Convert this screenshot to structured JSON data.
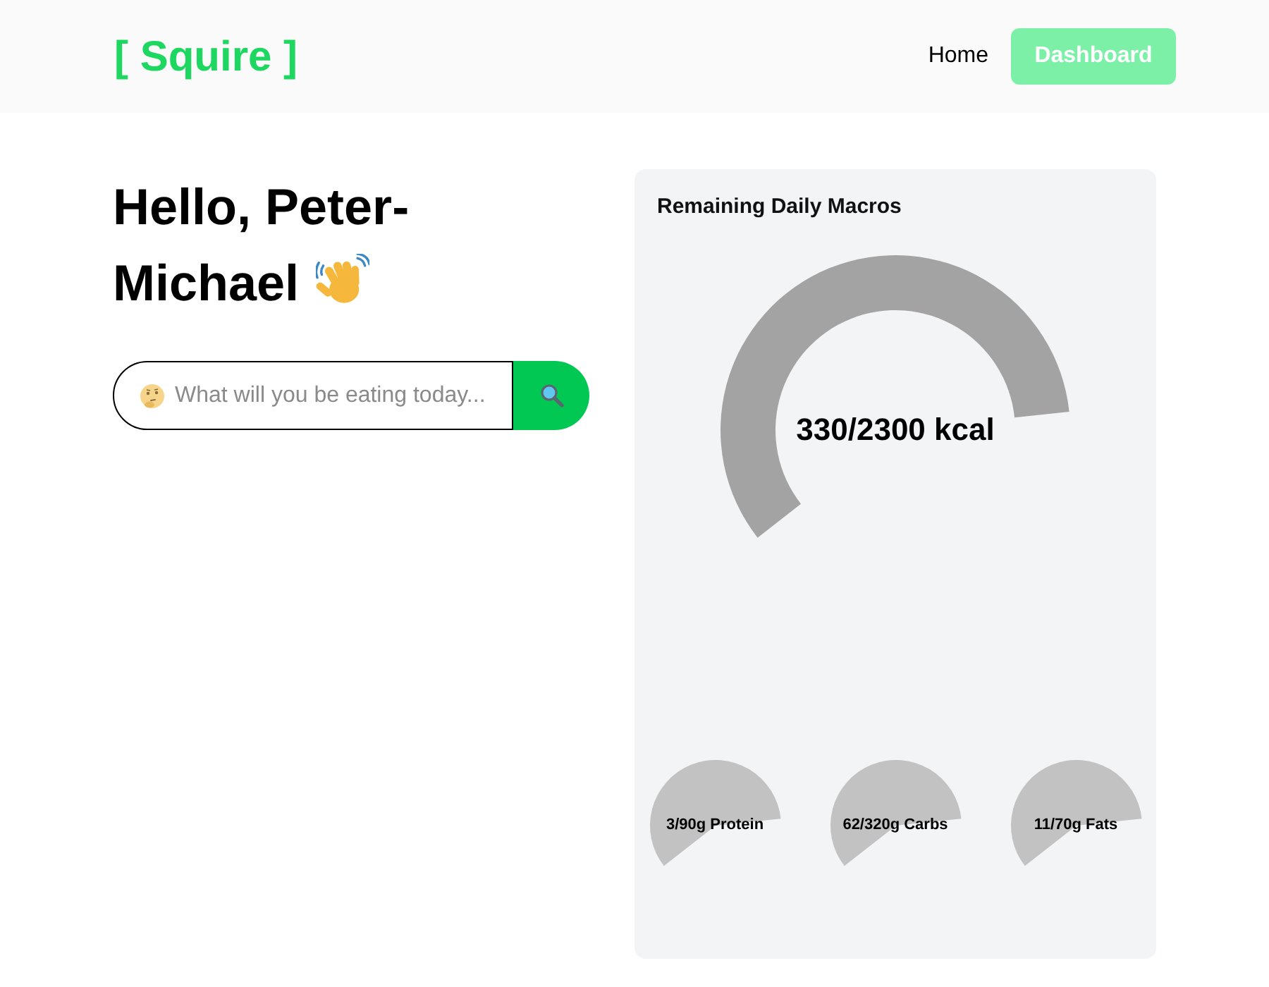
{
  "header": {
    "logo": "[ Squire ]",
    "nav": [
      {
        "label": "Home",
        "kind": "link"
      },
      {
        "label": "Dashboard",
        "kind": "button"
      }
    ]
  },
  "greeting": {
    "title_lines": [
      "Hello, Peter-",
      "Michael"
    ]
  },
  "search": {
    "placeholder": "What will you be eating today..."
  },
  "macros_card": {
    "title": "Remaining Daily Macros",
    "calories": {
      "reading": "330/2300 kcal"
    },
    "nutrients": [
      {
        "reading": "3/90g Protein"
      },
      {
        "reading": "62/320g Carbs"
      },
      {
        "reading": "11/70g Fats"
      }
    ]
  }
}
